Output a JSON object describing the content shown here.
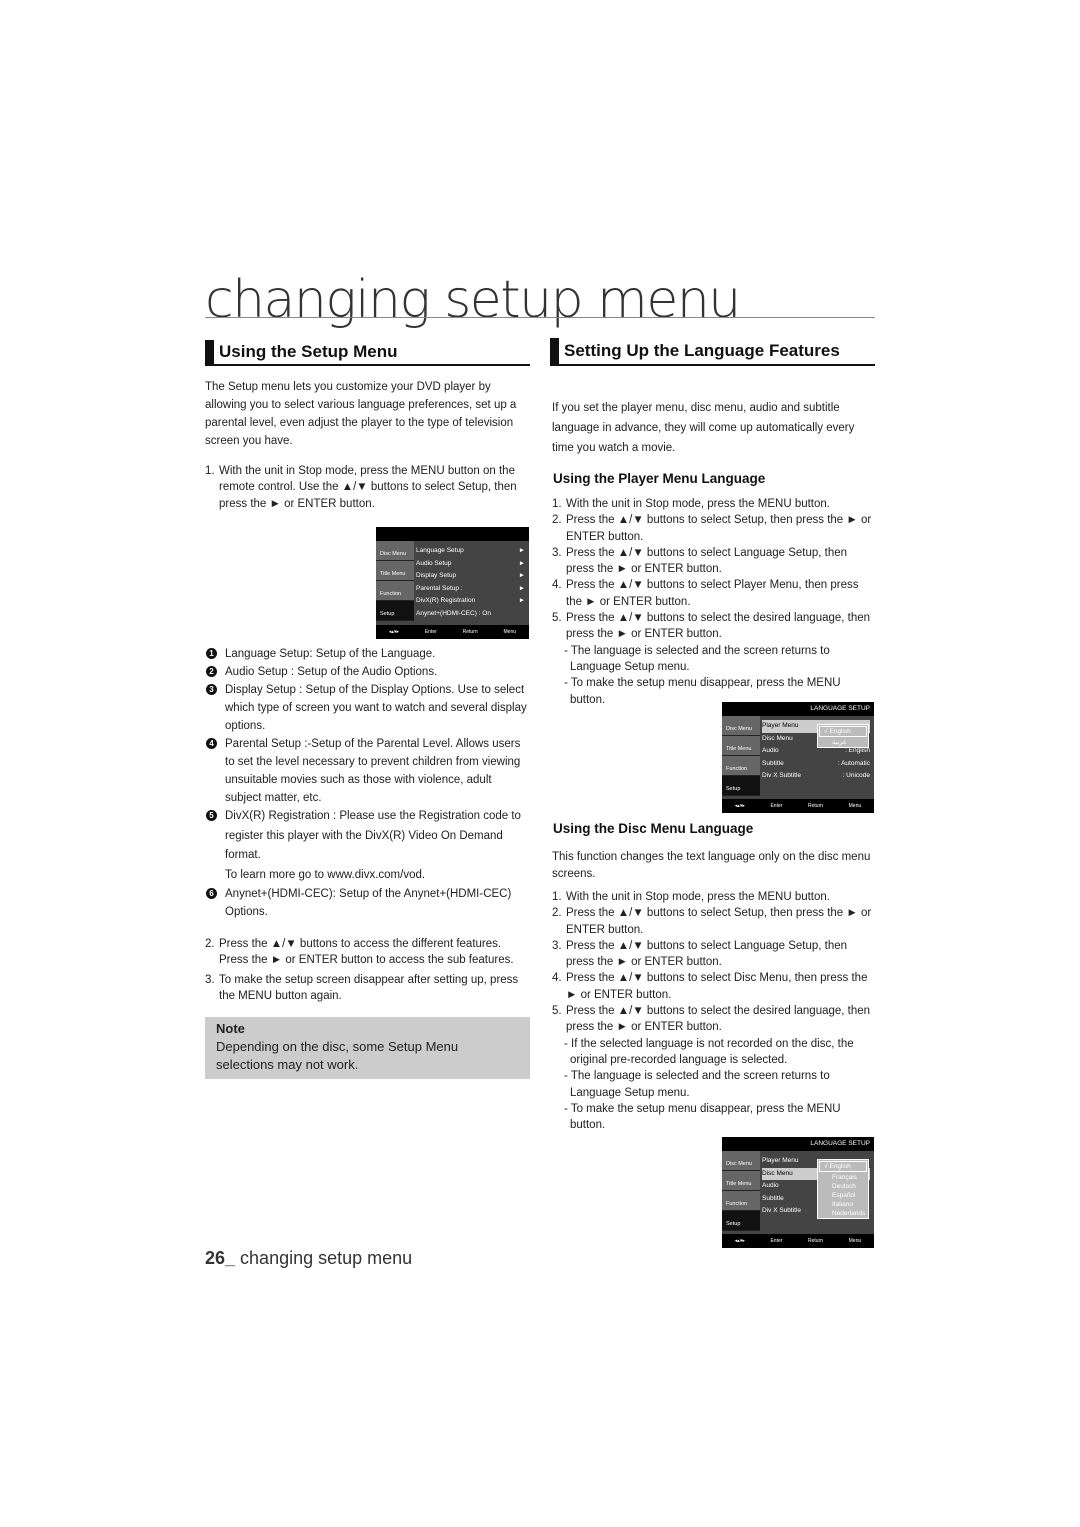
{
  "page_title": "changing setup menu",
  "left": {
    "heading": "Using the Setup Menu",
    "intro": "The Setup menu lets you customize your DVD player by allowing you to select various language preferences, set up a parental level, even adjust the player to the type of television screen you have.",
    "step1": "With the unit in Stop mode, press the MENU button on the remote control.  Use the ▲/▼ buttons to select Setup, then press the ► or ENTER button.",
    "bullets": [
      {
        "num": "1",
        "text": "Language Setup: Setup of the Language."
      },
      {
        "num": "2",
        "text": "Audio Setup : Setup of the Audio Options."
      },
      {
        "num": "3",
        "text": "Display Setup : Setup of the Display Options. Use to select which type of screen you want to watch and several display options."
      },
      {
        "num": "4",
        "text": "Parental Setup :-Setup of the Parental Level. Allows users to set the level necessary to prevent children from viewing unsuitable movies such as those with violence, adult subject matter, etc."
      },
      {
        "num": "5",
        "text": "DivX(R) Registration : Please use the Registration code to register this player with the DivX(R) Video On Demand format."
      },
      {
        "num": "",
        "text": "To learn more go to www.divx.com/vod."
      },
      {
        "num": "6",
        "text": "Anynet+(HDMI-CEC): Setup of the Anynet+(HDMI-CEC) Options."
      }
    ],
    "step2": "Press the ▲/▼ buttons to access the different  features. Press the ► or ENTER button to access the sub features.",
    "step3": "To make the setup screen disappear after setting up, press the MENU button again.",
    "note_title": "Note",
    "note_body": "Depending on the disc, some Setup Menu selections may not work."
  },
  "setup_menu": {
    "title": "",
    "side": [
      "Disc Menu",
      "Title Menu",
      "Function",
      "Setup"
    ],
    "items": [
      [
        "Language Setup",
        "►"
      ],
      [
        "Audio Setup",
        "►"
      ],
      [
        "Display Setup",
        "►"
      ],
      [
        "Parental Setup :",
        "►"
      ],
      [
        "DivX(R) Registration",
        "►"
      ],
      [
        "Anynet+(HDMI-CEC) : On",
        ""
      ]
    ],
    "bottom": [
      "Enter",
      "Return",
      "Menu"
    ]
  },
  "right": {
    "heading": "Setting Up the Language Features",
    "intro": "If you set the player menu, disc menu, audio and subtitle language in advance, they will come up automatically every time you watch a movie.",
    "sub1": "Using the Player Menu Language",
    "steps1": [
      "With the unit in Stop mode, press the MENU button.",
      "Press the ▲/▼ buttons to select Setup, then press the ► or ENTER button.",
      "Press the ▲/▼ buttons to select Language Setup, then press the ► or ENTER button.",
      "Press the ▲/▼ buttons to select Player Menu, then press the ► or ENTER button.",
      "Press the ▲/▼ buttons to select the desired language, then press the ► or ENTER button."
    ],
    "dashes1": [
      "The language is selected and the screen returns to Language Setup menu.",
      "To make the setup menu disappear, press the MENU button."
    ],
    "sub2": "Using the Disc Menu Language",
    "intro2": "This function changes the text language only on the disc menu screens.",
    "steps2": [
      "With the unit in Stop mode, press the MENU button.",
      "Press the ▲/▼ buttons to select Setup, then press the ► or ENTER button.",
      "Press the ▲/▼ buttons to select Language Setup, then press the ► or ENTER button.",
      "Press the  ▲/▼ buttons to select Disc Menu, then press the ► or ENTER  button.",
      "Press the ▲/▼ buttons to select the desired language, then press the ► or ENTER button."
    ],
    "dashes2": [
      "If the selected language is not recorded on  the disc, the original pre-recorded language is selected.",
      "The language is selected and the screen returns to Language Setup menu.",
      "To make the setup menu disappear, press the MENU button."
    ]
  },
  "lang_menu1": {
    "title": "LANGUAGE SETUP",
    "side": [
      "Disc Menu",
      "Title Menu",
      "Function",
      "Setup"
    ],
    "items": [
      [
        "Player Menu",
        ""
      ],
      [
        "Disc Menu",
        ""
      ],
      [
        "Audio",
        ": English"
      ],
      [
        "Subtitle",
        ": Automatic"
      ],
      [
        "Div X Subtitle",
        ": Unicode"
      ]
    ],
    "popup": [
      "√  English",
      "عربية"
    ],
    "bottom": [
      "Enter",
      "Return",
      "Menu"
    ]
  },
  "lang_menu2": {
    "title": "LANGUAGE SETUP",
    "side": [
      "Disc Menu",
      "Title Menu",
      "Function",
      "Setup"
    ],
    "items": [
      [
        "Player Menu",
        ""
      ],
      [
        "Disc Menu",
        ""
      ],
      [
        "Audio",
        ""
      ],
      [
        "Subtitle",
        ""
      ],
      [
        "Div X Subtitle",
        ""
      ]
    ],
    "popup": [
      "√  English",
      "Français",
      "Deutsch",
      "Español",
      "Italiano",
      "Nederlands"
    ],
    "bottom": [
      "Enter",
      "Return",
      "Menu"
    ]
  },
  "footer": {
    "page": "26_",
    "text": " changing setup menu"
  }
}
